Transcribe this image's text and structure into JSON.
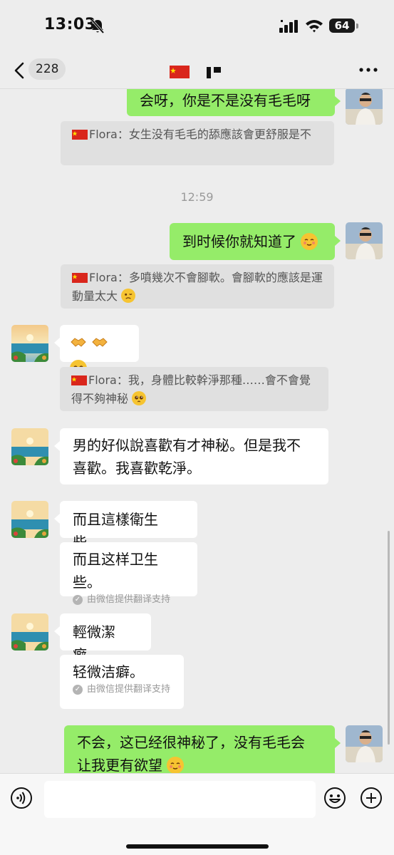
{
  "status_bar": {
    "time": "13:03",
    "battery": "64"
  },
  "nav": {
    "unread_count": "228"
  },
  "messages": {
    "m1": {
      "text": "会呀，你是不是没有毛毛呀"
    },
    "q1": {
      "sender": "Flora：",
      "text": "女生没有毛毛的舔應該會更舒服是不"
    },
    "ts1": "12:59",
    "m2": {
      "text": "到时候你就知道了"
    },
    "q2": {
      "sender": "Flora：",
      "text": "多噴幾次不會腳軟。會腳軟的應該是運動量太大"
    },
    "q3": {
      "sender": "Flora：",
      "text": "我，身體比較幹淨那種……會不會覺得不夠神秘"
    },
    "m3": {
      "line1": "男的好似說喜歡有才神秘。但是我不",
      "line2": "喜歡。我喜歡乾淨。"
    },
    "m4": {
      "text": "而且這樣衛生些。"
    },
    "m4t": {
      "text": "而且这样卫生些。",
      "note": "由微信提供翻译支持"
    },
    "m5": {
      "text": "輕微潔癖。"
    },
    "m5t": {
      "text": "轻微洁癖。",
      "note": "由微信提供翻译支持"
    },
    "m6": {
      "line1": "不会，这已经很神秘了，没有毛毛会",
      "line2": "让我更有欲望"
    }
  },
  "icons": {
    "back": "chevron-left-icon",
    "more": "more-dots-icon",
    "voice": "voice-icon",
    "emoji": "emoji-icon",
    "plus": "plus-icon"
  },
  "colors": {
    "sent_bubble": "#95ec69",
    "received_bubble": "#ffffff",
    "quote_bg": "#e0e0e0",
    "background": "#ededed"
  }
}
